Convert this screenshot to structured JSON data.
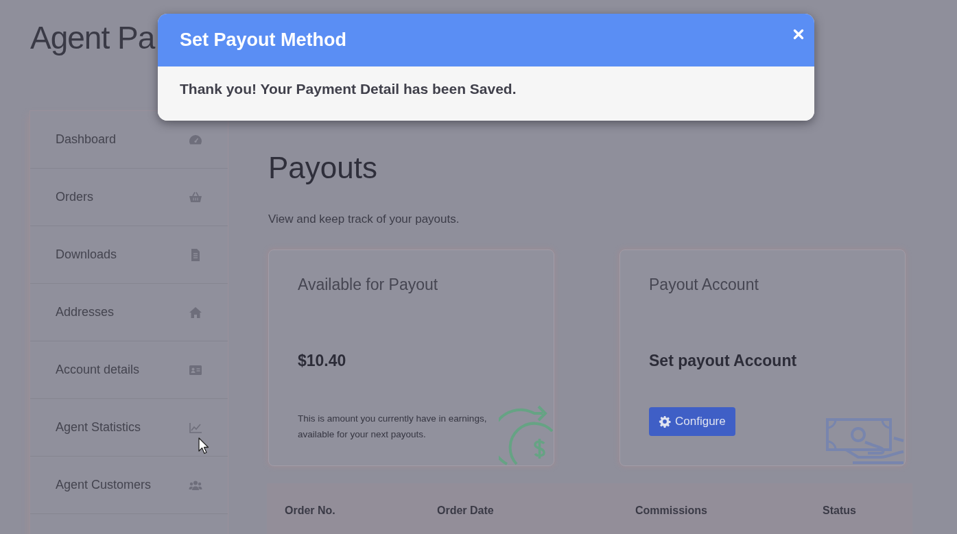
{
  "page_title": "Agent Pa",
  "sidebar": {
    "items": [
      {
        "label": "Dashboard",
        "selected": false
      },
      {
        "label": "Orders",
        "selected": false
      },
      {
        "label": "Downloads",
        "selected": false
      },
      {
        "label": "Addresses",
        "selected": false
      },
      {
        "label": "Account details",
        "selected": false
      },
      {
        "label": "Agent Statistics",
        "selected": false
      },
      {
        "label": "Agent Customers",
        "selected": false
      }
    ]
  },
  "main": {
    "heading": "Payouts",
    "description": "View and keep track of your payouts.",
    "cards": [
      {
        "kind": "balance",
        "title": "Available for Payout",
        "value": "$10.40",
        "description": "This is amount you currently have in earnings, available for your next payouts."
      },
      {
        "kind": "account",
        "title": "Payout Account",
        "value": "Set payout Account",
        "button": "Configure"
      }
    ],
    "table": {
      "columns": [
        "Order No.",
        "Order Date",
        "Commissions",
        "Status"
      ]
    }
  },
  "modal": {
    "title": "Set Payout Method",
    "message": "Thank you! Your Payment Detail has been Saved."
  }
}
